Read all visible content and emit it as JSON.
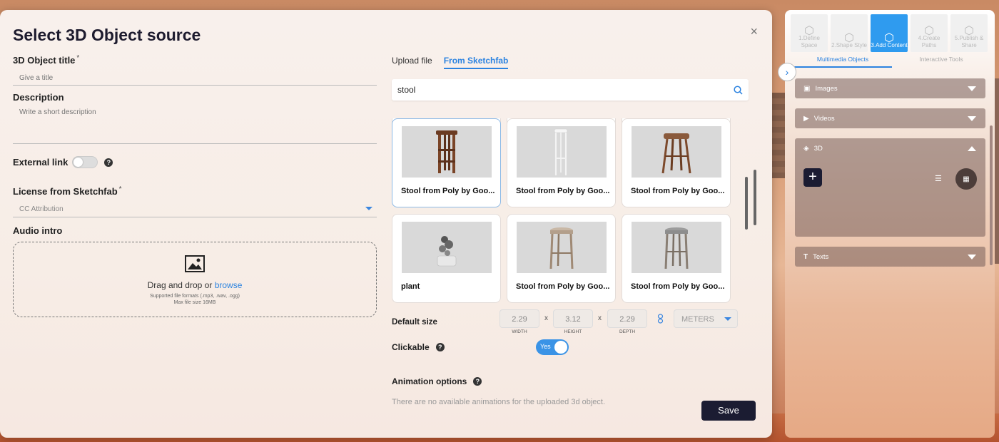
{
  "modal": {
    "title": "Select 3D Object source",
    "close": "×"
  },
  "form": {
    "title_label": "3D Object title",
    "required_mark": "*",
    "title_placeholder": "Give a title",
    "description_label": "Description",
    "description_placeholder": "Write a short description",
    "external_link_label": "External link",
    "license_label": "License from Sketchfab",
    "license_value": "CC Attribution",
    "audio_label": "Audio intro",
    "dropzone_text": "Drag and drop or",
    "dropzone_link": "browse",
    "dropzone_formats": "Supported file formats (.mp3, .wav, .ogg)",
    "dropzone_max": "Max file size 16MB"
  },
  "source": {
    "tabs": [
      "Upload file",
      "From Sketchfab"
    ],
    "active_tab": "From Sketchfab",
    "search_value": "stool",
    "results": [
      {
        "title": "Stool from Poly by Goo...",
        "selected": true
      },
      {
        "title": "Stool from Poly by Goo...",
        "selected": false
      },
      {
        "title": "Stool from Poly by Goo...",
        "selected": false
      },
      {
        "title": "plant",
        "selected": false
      },
      {
        "title": "Stool from Poly by Goo...",
        "selected": false
      },
      {
        "title": "Stool from Poly by Goo...",
        "selected": false
      }
    ]
  },
  "size": {
    "label": "Default size",
    "width": "2.29",
    "height": "3.12",
    "depth": "2.29",
    "width_label": "WIDTH",
    "height_label": "HEIGHT",
    "depth_label": "DEPTH",
    "times": "x",
    "unit": "METERS"
  },
  "clickable": {
    "label": "Clickable",
    "toggle_text": "Yes",
    "value": true
  },
  "animation": {
    "label": "Animation options",
    "note": "There are no available animations for the uploaded 3d object."
  },
  "save_label": "Save",
  "sidepanel": {
    "steps": [
      {
        "label": "1.Define Space",
        "active": false
      },
      {
        "label": "2.Shape Style",
        "active": false
      },
      {
        "label": "3.Add Content",
        "active": true
      },
      {
        "label": "4.Create Paths",
        "active": false
      },
      {
        "label": "5.Publish & Share",
        "active": false
      }
    ],
    "tabs": [
      "Multimedia Objects",
      "Interactive Tools"
    ],
    "sections": {
      "images": "Images",
      "videos": "Videos",
      "threed": "3D",
      "texts": "Texts"
    }
  },
  "colors": {
    "accent": "#2c83e0",
    "dark_button": "#1b1c32",
    "active_step": "#2f9bef"
  }
}
